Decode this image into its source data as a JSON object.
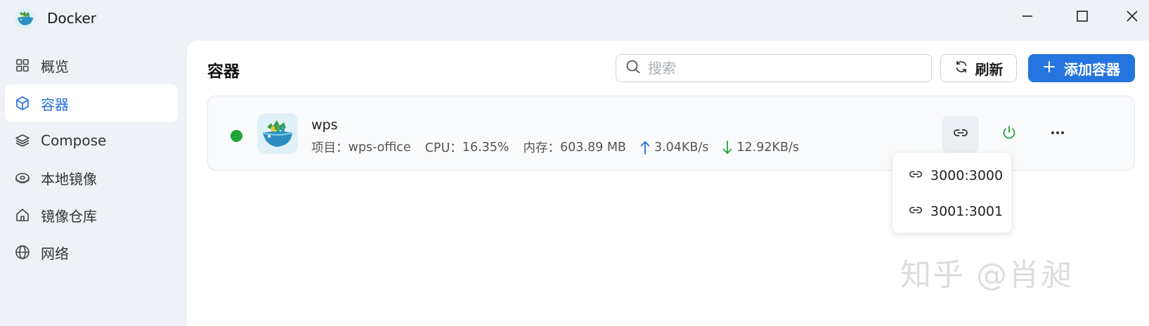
{
  "app": {
    "title": "Docker",
    "icon": "docker-whale-icon"
  },
  "window_controls": [
    "minimize-icon",
    "maximize-icon",
    "close-icon"
  ],
  "sidebar": {
    "items": [
      {
        "label": "概览",
        "icon": "grid-icon",
        "active": false
      },
      {
        "label": "容器",
        "icon": "cube-icon",
        "active": true
      },
      {
        "label": "Compose",
        "icon": "layers-icon",
        "active": false
      },
      {
        "label": "本地镜像",
        "icon": "disk-icon",
        "active": false
      },
      {
        "label": "镜像仓库",
        "icon": "home-icon",
        "active": false
      },
      {
        "label": "网络",
        "icon": "globe-icon",
        "active": false
      }
    ]
  },
  "main": {
    "title": "容器",
    "search": {
      "placeholder": "搜索",
      "value": ""
    },
    "refresh_label": "刷新",
    "add_label": "添加容器"
  },
  "containers": [
    {
      "name": "wps",
      "status": "running",
      "project_label": "项目：",
      "project": "wps-office",
      "cpu_label": "CPU：",
      "cpu": "16.35%",
      "mem_label": "内存：",
      "mem": "603.89 MB",
      "upload": "3.04KB/s",
      "download": "12.92KB/s",
      "ports": [
        "3000:3000",
        "3001:3001"
      ]
    }
  ],
  "watermark": "知乎 @肖昶",
  "colors": {
    "accent": "#2475e0",
    "status_running": "#22a33a",
    "upload_arrow": "#2b6fd6",
    "download_arrow": "#22a33a",
    "sidebar_bg": "#eef1f6"
  }
}
